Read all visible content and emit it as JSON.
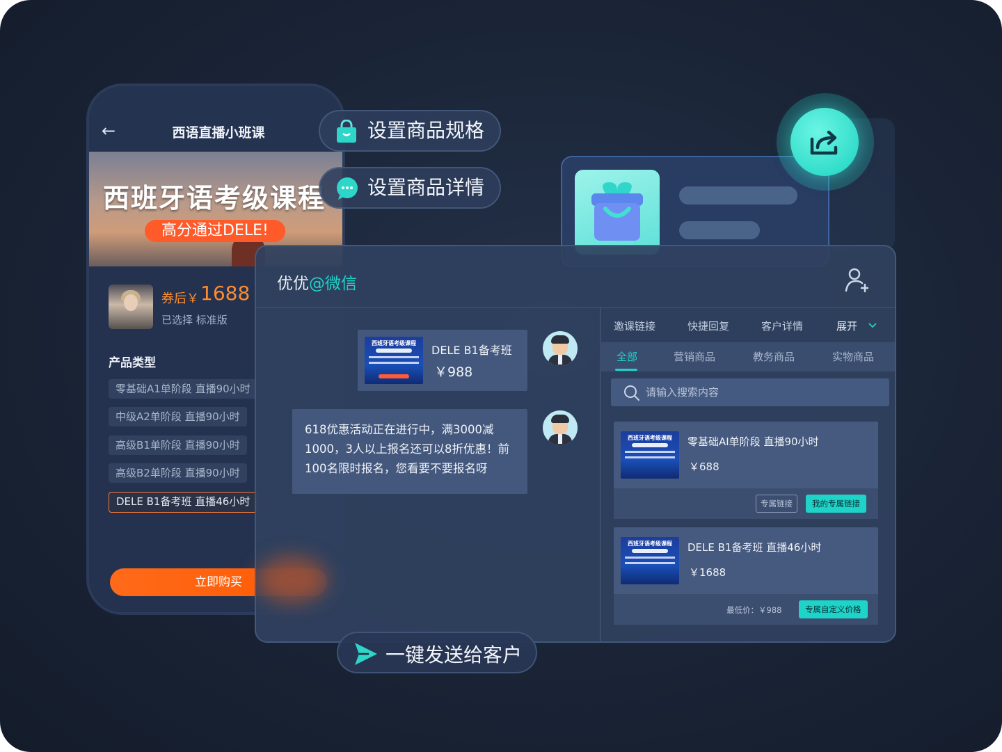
{
  "phone": {
    "title": "西语直播小班课",
    "hero_title": "西班牙语考级课程",
    "hero_badge": "高分通过DELE!",
    "price_prefix": "券后￥",
    "price": "1688",
    "selected": "已选择 标准版",
    "product_type_label": "产品类型",
    "options": [
      "零基础A1单阶段 直播90小时",
      "中级A2单阶段 直播90小时",
      "高级B1单阶段 直播90小时",
      "高级B2单阶段 直播90小时",
      "DELE B1备考班 直播46小时"
    ],
    "buy_label": "立即购买"
  },
  "pills": {
    "spec": "设置商品规格",
    "detail": "设置商品详情",
    "send": "一键发送给客户"
  },
  "chat": {
    "contact_name": "优优",
    "contact_source": "@微信",
    "message1": {
      "title": "DELE B1备考班",
      "price": "￥988"
    },
    "message2": "618优惠活动正在进行中，满3000减1000，3人以上报名还可以8折优惠！前100名限时报名，您看要不要报名呀",
    "poster_title": "西班牙语考级课程"
  },
  "right_panel": {
    "top_tabs": [
      "邀课链接",
      "快捷回复",
      "客户详情",
      "展开"
    ],
    "category_tabs": [
      "全部",
      "营销商品",
      "教务商品",
      "实物商品"
    ],
    "search_placeholder": "请输入搜索内容",
    "products": [
      {
        "name": "零基础AI单阶段 直播90小时",
        "price": "￥688",
        "btn_ghost": "专属链接",
        "btn_primary": "我的专属链接"
      },
      {
        "name": "DELE B1备考班 直播46小时",
        "price": "￥1688",
        "low_price": "最低价：￥988",
        "btn_primary": "专属自定义价格"
      }
    ]
  },
  "colors": {
    "accent": "#1ed4c8",
    "orange": "#ff5a00",
    "background": "#1a2436"
  }
}
